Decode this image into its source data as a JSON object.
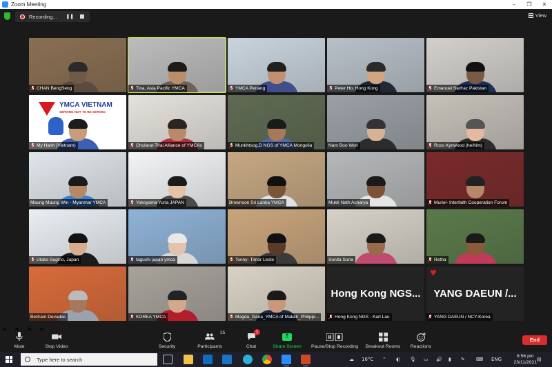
{
  "window": {
    "title": "Zoom Meeting",
    "controls": [
      "–",
      "❐",
      "✕"
    ]
  },
  "recording": {
    "label": "Recording..."
  },
  "view": {
    "label": "View"
  },
  "participants": [
    {
      "name": "CHAN BengSeng",
      "muted": true
    },
    {
      "name": "Tina, Asia Pacific YMCA",
      "muted": true,
      "active_speaker": true
    },
    {
      "name": "YMCA Penang",
      "muted": true
    },
    {
      "name": "Peter Ho, Hong Kong",
      "muted": true
    },
    {
      "name": "Emanuel Sarfraz Pakistan",
      "muted": true
    },
    {
      "name": "My Hanh (Vietnam)",
      "muted": true
    },
    {
      "name": "Chularat-Thai Alliance of YMCAs",
      "muted": true
    },
    {
      "name": "Munkhtsog.D NGS of YMCA Mongolia",
      "muted": true
    },
    {
      "name": "Nam Boo Won",
      "muted": false
    },
    {
      "name": "Ross Kynwood (he/him)",
      "muted": true
    },
    {
      "name": "Maung Maung Win - Myanmar YMCA",
      "muted": false
    },
    {
      "name": "Yokoyama Yuria JAPAN",
      "muted": true
    },
    {
      "name": "Brownson Sri Lanka YMCA",
      "muted": false
    },
    {
      "name": "Mukti Nath Acharya",
      "muted": false
    },
    {
      "name": "Muriel- Interfaith Cooperation Forum",
      "muted": true
    },
    {
      "name": "Utako Sugino, Japan",
      "muted": true
    },
    {
      "name": "taguchi japan ymca",
      "muted": true
    },
    {
      "name": "Tonny- Timor Leste",
      "muted": true
    },
    {
      "name": "Sunita Suna",
      "muted": false
    },
    {
      "name": "Retha",
      "muted": true
    },
    {
      "name": "Bertram Devadas",
      "muted": false
    },
    {
      "name": "KOREA YMCA",
      "muted": true
    },
    {
      "name": "Magda_Gana_YMCA of Makati_Philippi...",
      "muted": true
    },
    {
      "name": "Hong Kong NGS - Karl Lau",
      "muted": true,
      "display_name": "Hong Kong NGS..."
    },
    {
      "name": "YANG DAEUN / NCY-Korea",
      "muted": true,
      "display_name": "YANG DAEUN /..."
    }
  ],
  "in_video_text": {
    "vietnam_banner_title": "YMCA VIETNAM",
    "vietnam_banner_tagline": "SERVING NOT TO BE SERVED"
  },
  "toolbar": {
    "mute": "Mute",
    "stop_video": "Stop Video",
    "security": "Security",
    "participants": "Participants",
    "participant_count": "25",
    "chat": "Chat",
    "chat_badge": "1",
    "share_screen": "Share Screen",
    "pause_recording": "Pause/Stop Recording",
    "breakout_rooms": "Breakout Rooms",
    "reactions": "Reactions",
    "end": "End"
  },
  "taskbar": {
    "search_placeholder": "Type here to search",
    "weather": "16°C",
    "language": "ENG",
    "time": "6:56 pm",
    "date": "23/11/2021"
  },
  "colors": {
    "active_speaker_border": "#c8e53a",
    "share_screen_green": "#1ed760",
    "end_red": "#d92d2d",
    "mute_red": "#e02828"
  }
}
